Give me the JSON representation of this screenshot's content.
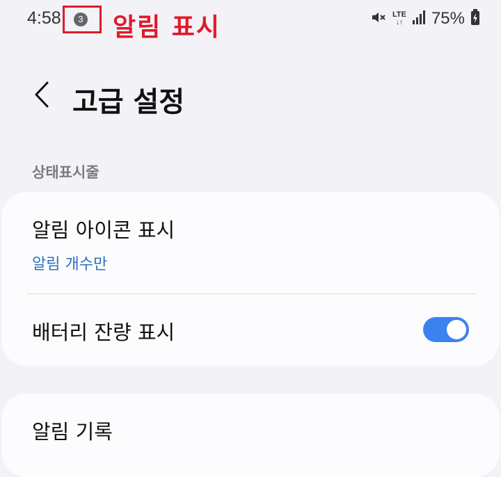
{
  "status_bar": {
    "time": "4:58",
    "notification_count": "3",
    "battery_percent": "75%",
    "network_label": "LTE",
    "network_arrows": "↓↑",
    "icons": [
      "mute-icon",
      "lte-icon",
      "signal-icon",
      "battery-charging-icon"
    ]
  },
  "annotation": {
    "text": "알림 표시",
    "color": "#e0192b"
  },
  "header": {
    "back_icon": "chevron-left-icon",
    "title": "고급 설정"
  },
  "sections": {
    "status_bar_section": {
      "label": "상태표시줄",
      "items": [
        {
          "title": "알림 아이콘 표시",
          "subtitle": "알림 개수만"
        },
        {
          "title": "배터리 잔량 표시",
          "toggle_on": true
        }
      ]
    },
    "history_section": {
      "items": [
        {
          "title": "알림 기록"
        }
      ]
    }
  },
  "colors": {
    "accent": "#3b82f1",
    "link": "#2e6fc2",
    "background": "#f2f2f7"
  }
}
